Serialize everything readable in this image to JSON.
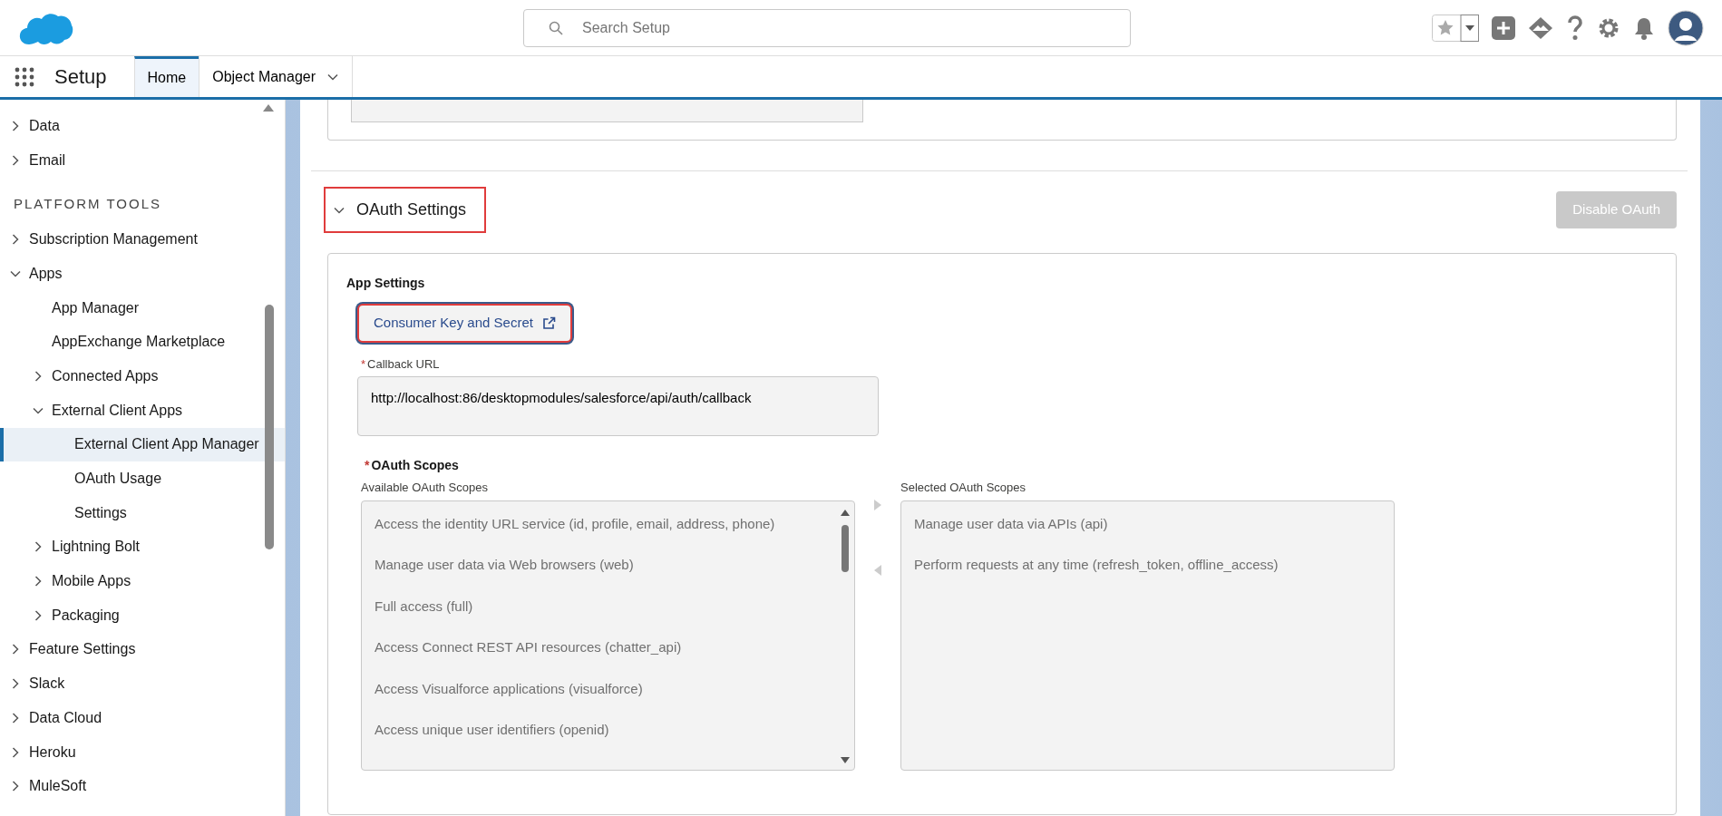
{
  "header": {
    "search": {
      "placeholder": "Search Setup"
    }
  },
  "nav": {
    "app_title": "Setup",
    "tabs": [
      {
        "label": "Home",
        "selected": true,
        "dropdown": false
      },
      {
        "label": "Object Manager",
        "selected": false,
        "dropdown": true
      }
    ]
  },
  "sidebar": {
    "items": [
      {
        "kind": "item",
        "label": "Data",
        "expanded": false,
        "selected": false
      },
      {
        "kind": "item",
        "label": "Email",
        "expanded": false,
        "selected": false
      },
      {
        "kind": "heading",
        "label": "PLATFORM TOOLS"
      },
      {
        "kind": "item",
        "label": "Subscription Management",
        "expanded": false,
        "selected": false
      },
      {
        "kind": "item",
        "label": "Apps",
        "expanded": true,
        "selected": false,
        "children": [
          {
            "label": "App Manager",
            "selected": false
          },
          {
            "label": "AppExchange Marketplace",
            "selected": false
          },
          {
            "label": "Connected Apps",
            "expanded": false,
            "selected": false
          },
          {
            "label": "External Client Apps",
            "expanded": true,
            "selected": false,
            "children": [
              {
                "label": "External Client App Manager",
                "selected": true
              },
              {
                "label": "OAuth Usage",
                "selected": false
              },
              {
                "label": "Settings",
                "selected": false
              }
            ]
          },
          {
            "label": "Lightning Bolt",
            "expanded": false,
            "selected": false
          },
          {
            "label": "Mobile Apps",
            "expanded": false,
            "selected": false
          },
          {
            "label": "Packaging",
            "expanded": false,
            "selected": false
          }
        ]
      },
      {
        "kind": "item",
        "label": "Feature Settings",
        "expanded": false,
        "selected": false
      },
      {
        "kind": "item",
        "label": "Slack",
        "expanded": false,
        "selected": false
      },
      {
        "kind": "item",
        "label": "Data Cloud",
        "expanded": false,
        "selected": false
      },
      {
        "kind": "item",
        "label": "Heroku",
        "expanded": false,
        "selected": false
      },
      {
        "kind": "item",
        "label": "MuleSoft",
        "expanded": false,
        "selected": false
      }
    ]
  },
  "oauth_section": {
    "title": "OAuth Settings",
    "expanded": true,
    "highlighted": true,
    "disable_button": {
      "label": "Disable OAuth",
      "disabled": true
    },
    "app_settings": {
      "heading": "App Settings",
      "consumer_button": {
        "label": "Consumer Key and Secret",
        "highlighted": true
      },
      "callback_url": {
        "label": "Callback URL",
        "required_mark": "*",
        "value": "http://localhost:86/desktopmodules/salesforce/api/auth/callback"
      }
    },
    "scopes": {
      "label": "OAuth Scopes",
      "required_mark": "*",
      "available": {
        "label": "Available OAuth Scopes",
        "items": [
          "Access the identity URL service (id, profile, email, address, phone)",
          "Manage user data via Web browsers (web)",
          "Full access (full)",
          "Access Connect REST API resources (chatter_api)",
          "Access Visualforce applications (visualforce)",
          "Access unique user identifiers (openid)"
        ]
      },
      "selected": {
        "label": "Selected OAuth Scopes",
        "items": [
          "Manage user data via APIs (api)",
          "Perform requests at any time (refresh_token, offline_access)"
        ]
      }
    }
  }
}
